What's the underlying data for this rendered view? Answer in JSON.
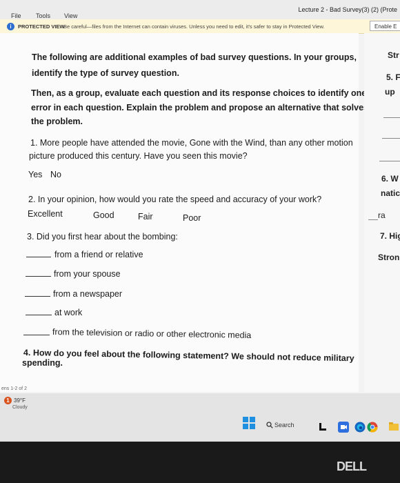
{
  "menubar": {
    "items": [
      "File",
      "Tools",
      "View"
    ],
    "doc_title": "Lecture 2 - Bad Survey(3) (2) (Prote"
  },
  "protected_view": {
    "label": "PROTECTED VIEW",
    "message": "Be careful—files from the Internet can contain viruses. Unless you need to edit, it's safer to stay in Protected View.",
    "enable_button": "Enable E"
  },
  "document": {
    "intro1_line1": "The following are additional examples of bad survey questions. In your groups,",
    "intro1_line2": "identify the type of survey question.",
    "intro2_line1": "Then, as a group, evaluate each question and its response choices to identify one",
    "intro2_line2": "error in each question. Explain the problem and propose an alternative that solves",
    "intro2_line3": "the problem.",
    "q1_line1": "1. More people have attended the movie, Gone with the Wind, than any other motion",
    "q1_line2": "picture produced this century. Have you seen this movie?",
    "q1_yes": "Yes",
    "q1_no": "No",
    "q2": "2. In your opinion, how would you rate the speed and accuracy of your work?",
    "q2_options": [
      "Excellent",
      "Good",
      "Fair",
      "Poor"
    ],
    "q3": "3. Did you first hear about the bombing:",
    "q3_options": [
      "from a friend or relative",
      "from your spouse",
      "from a newspaper",
      "at work",
      "from the television or radio or other electronic media"
    ],
    "q4_line1": "4. How do you feel about the following statement? We should not reduce military",
    "q4_line2": "spending."
  },
  "right_page": {
    "texts": [
      "Str",
      "5. F",
      "up",
      "6. W",
      "natic",
      "ra",
      "7. Hig",
      "Stron"
    ]
  },
  "status": {
    "page_count": "ens 1-2 of 2"
  },
  "taskbar": {
    "weather_temp": "39°F",
    "weather_condition": "Cloudy",
    "search_label": "Search"
  },
  "bezel": {
    "logo": "DELL"
  }
}
